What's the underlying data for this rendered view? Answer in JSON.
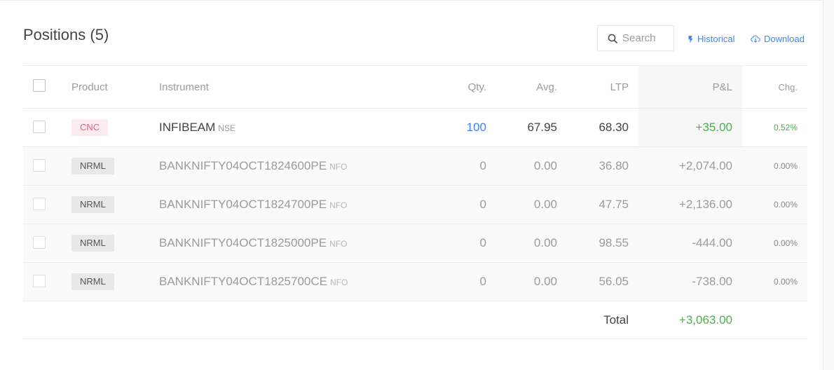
{
  "page": {
    "title": "Positions (5)"
  },
  "toolbar": {
    "search_placeholder": "Search",
    "historical_label": "Historical",
    "download_label": "Download"
  },
  "table": {
    "headers": {
      "product": "Product",
      "instrument": "Instrument",
      "qty": "Qty.",
      "avg": "Avg.",
      "ltp": "LTP",
      "pnl": "P&L",
      "chg": "Chg."
    },
    "rows": [
      {
        "product": "CNC",
        "instrument": "INFIBEAM",
        "exchange": "NSE",
        "qty": "100",
        "avg": "67.95",
        "ltp": "68.30",
        "pnl": "+35.00",
        "chg": "0.52%"
      },
      {
        "product": "NRML",
        "instrument": "BANKNIFTY04OCT1824600PE",
        "exchange": "NFO",
        "qty": "0",
        "avg": "0.00",
        "ltp": "36.80",
        "pnl": "+2,074.00",
        "chg": "0.00%"
      },
      {
        "product": "NRML",
        "instrument": "BANKNIFTY04OCT1824700PE",
        "exchange": "NFO",
        "qty": "0",
        "avg": "0.00",
        "ltp": "47.75",
        "pnl": "+2,136.00",
        "chg": "0.00%"
      },
      {
        "product": "NRML",
        "instrument": "BANKNIFTY04OCT1825000PE",
        "exchange": "NFO",
        "qty": "0",
        "avg": "0.00",
        "ltp": "98.55",
        "pnl": "-444.00",
        "chg": "0.00%"
      },
      {
        "product": "NRML",
        "instrument": "BANKNIFTY04OCT1825700CE",
        "exchange": "NFO",
        "qty": "0",
        "avg": "0.00",
        "ltp": "56.05",
        "pnl": "-738.00",
        "chg": "0.00%"
      }
    ],
    "total_label": "Total",
    "total_value": "+3,063.00"
  },
  "colors": {
    "accent_blue": "#4184f3",
    "profit_green": "#4caf50",
    "cnc_badge_text": "#e85c7a",
    "cnc_badge_bg": "#fdecef",
    "nrml_badge_bg": "#e8e8e8"
  },
  "icons": {
    "search": "search-icon",
    "historical": "historical-icon",
    "download": "cloud-download-icon"
  }
}
